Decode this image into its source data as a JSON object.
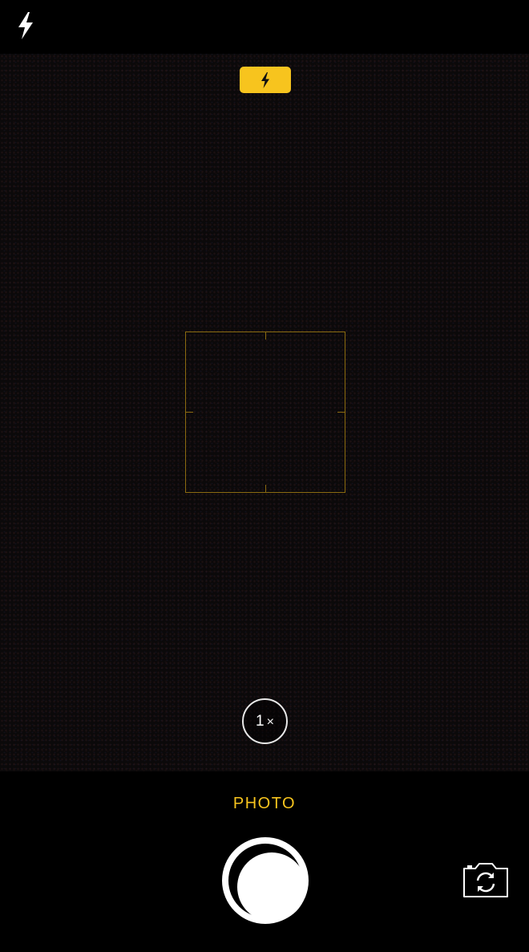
{
  "top_bar": {
    "flash_icon": "lightning-bolt-icon"
  },
  "viewfinder": {
    "flash_indicator_icon": "lightning-bolt-icon",
    "focus_box": "focus-box"
  },
  "zoom": {
    "value": "1",
    "suffix": "×"
  },
  "bottom_bar": {
    "mode_label": "PHOTO",
    "shutter_icon": "shutter-button",
    "flip_camera_icon": "camera-flip-icon"
  },
  "colors": {
    "accent": "#f7c41e",
    "background": "#000000",
    "focus_box": "#8a6a10"
  }
}
